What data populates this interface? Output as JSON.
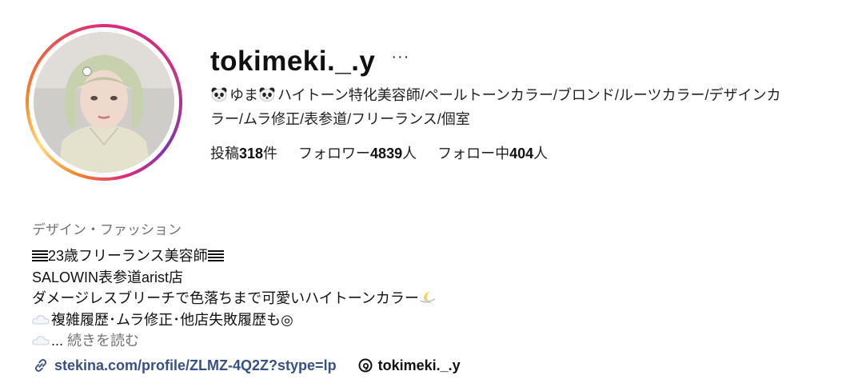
{
  "profile": {
    "username": "tokimeki._.y",
    "more_label": "···",
    "fullname_line1": "ゆま",
    "fullname_line1_rest": "ハイトーン特化美容師/ペールトーンカラー/ブロンド/ルーツカラー/デザインカ",
    "fullname_line2": "ラー/ムラ修正/表参道/フリーランス/個室",
    "stats": {
      "posts_prefix": "投稿",
      "posts_count": "318",
      "posts_suffix": "件",
      "followers_prefix": "フォロワー",
      "followers_count": "4839",
      "followers_suffix": "人",
      "following_prefix": "フォロー中",
      "following_count": "404",
      "following_suffix": "人"
    },
    "category": "デザイン・ファッション",
    "bio": {
      "line1": "23歳フリーランス美容師",
      "line2": "SALOWIN表参道arist店",
      "line3": "ダメージレスブリーチで色落ちまで可愛いハイトーンカラー",
      "line4": "複雑履歴･ムラ修正･他店失敗履歴も◎",
      "line5_dots": "... ",
      "line5_more": "続きを読む"
    },
    "link_text": "stekina.com/profile/ZLMZ-4Q2Z?stype=lp",
    "threads_text": "tokimeki._.y"
  },
  "icons": [
    "avatar",
    "panda-icon",
    "bars-icon",
    "moon-icon",
    "cloud-icon",
    "link-icon",
    "threads-icon"
  ],
  "colors": {
    "link": "#385185",
    "muted": "#737373"
  }
}
